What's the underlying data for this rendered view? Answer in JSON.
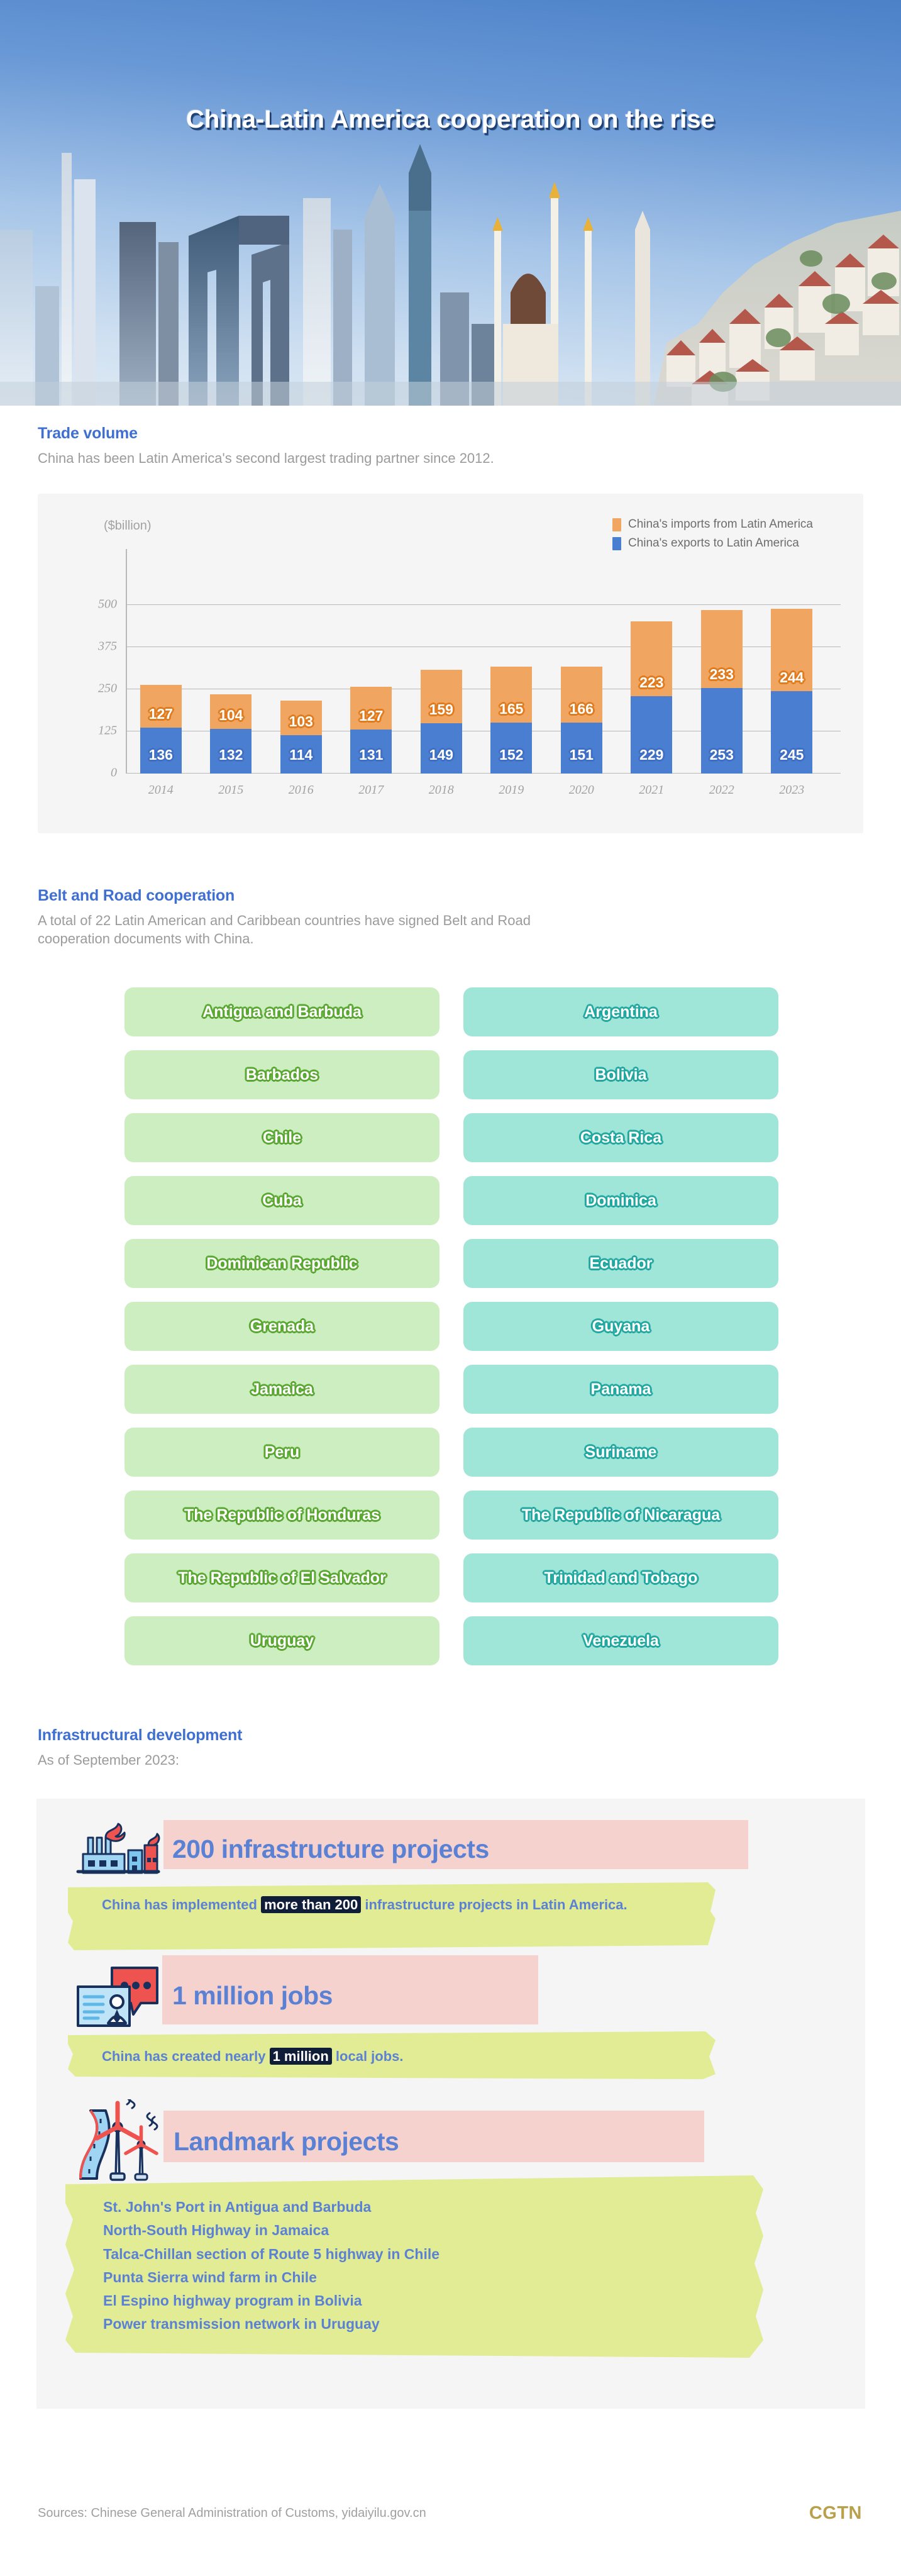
{
  "hero": {
    "title": "China-Latin America cooperation on the rise"
  },
  "trade": {
    "section_title": "Trade volume",
    "section_subtitle": "China has been Latin America's second largest trading partner since 2012.",
    "unit_label": "($billion)",
    "legend": [
      {
        "label": "China's imports from Latin America",
        "color": "#f0a560"
      },
      {
        "label": "China's exports to Latin America",
        "color": "#4a7ed1"
      }
    ]
  },
  "chart_data": {
    "type": "bar",
    "subtype": "stacked-column",
    "title": "Trade volume",
    "subtitle": "China has been Latin America's second largest trading partner since 2012.",
    "xlabel": "",
    "ylabel": "($billion)",
    "ylim": [
      0,
      625
    ],
    "yticks": [
      0,
      125,
      250,
      375,
      500
    ],
    "grid": true,
    "legend_position": "top-right",
    "categories": [
      "2014",
      "2015",
      "2016",
      "2017",
      "2018",
      "2019",
      "2020",
      "2021",
      "2022",
      "2023"
    ],
    "series": [
      {
        "name": "China's exports to Latin America",
        "color": "#4a7ed1",
        "values": [
          136,
          132,
          114,
          131,
          149,
          152,
          151,
          229,
          253,
          245
        ]
      },
      {
        "name": "China's imports from Latin America",
        "color": "#f0a560",
        "values": [
          127,
          104,
          103,
          127,
          159,
          165,
          166,
          223,
          233,
          244
        ]
      }
    ],
    "totals": [
      263,
      236,
      217,
      258,
      308,
      317,
      317,
      452,
      486,
      489
    ]
  },
  "belt_road": {
    "section_title": "Belt and Road cooperation",
    "section_subtitle": "A total of 22 Latin American and Caribbean countries have signed Belt and Road cooperation documents with China.",
    "countries_left": [
      "Antigua and Barbuda",
      "Barbados",
      "Chile",
      "Cuba",
      "Dominican Republic",
      "Grenada",
      "Jamaica",
      "Peru",
      "The Republic of Honduras",
      "The Republic of El Salvador",
      "Uruguay"
    ],
    "countries_right": [
      "Argentina",
      "Bolivia",
      "Costa Rica",
      "Dominica",
      "Ecuador",
      "Guyana",
      "Panama",
      "Suriname",
      "The Republic of Nicaragua",
      "Trinidad and Tobago",
      "Venezuela"
    ],
    "left_color": "#cdeec0",
    "right_color": "#9fe5d8"
  },
  "infrastructure": {
    "section_title": "Infrastructural development",
    "section_subtitle": "As of September 2023:",
    "blocks": [
      {
        "icon": "factory-icon",
        "title": "200 infrastructure projects",
        "body_before": "China has implemented ",
        "body_mark": "more than 200",
        "body_after": " infrastructure projects in Latin America."
      },
      {
        "icon": "job-card-icon",
        "title": "1 million jobs",
        "body_before": "China has created nearly ",
        "body_mark": "1 million",
        "body_after": " local jobs."
      },
      {
        "icon": "windmill-road-icon",
        "title": "Landmark projects",
        "items": [
          "St. John's Port in Antigua and Barbuda",
          "North-South Highway in Jamaica",
          "Talca-Chillan section of Route 5 highway in Chile",
          "Punta Sierra wind farm in Chile",
          "El Espino highway program in Bolivia",
          "Power transmission network in Uruguay"
        ]
      }
    ],
    "highlight_pink": "#f6d2cf",
    "highlight_lime": "#e1ec94",
    "text_blue": "#5b81d4"
  },
  "footer": {
    "sources": "Sources: Chinese General Administration of Customs, yidaiyilu.gov.cn",
    "logo": "CGTN"
  }
}
